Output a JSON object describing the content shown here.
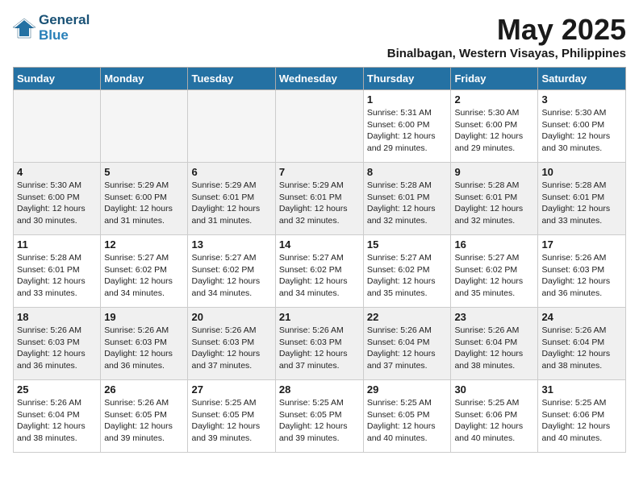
{
  "header": {
    "logo_line1": "General",
    "logo_line2": "Blue",
    "month_year": "May 2025",
    "location": "Binalbagan, Western Visayas, Philippines"
  },
  "days_of_week": [
    "Sunday",
    "Monday",
    "Tuesday",
    "Wednesday",
    "Thursday",
    "Friday",
    "Saturday"
  ],
  "weeks": [
    [
      {
        "day": "",
        "info": ""
      },
      {
        "day": "",
        "info": ""
      },
      {
        "day": "",
        "info": ""
      },
      {
        "day": "",
        "info": ""
      },
      {
        "day": "1",
        "info": "Sunrise: 5:31 AM\nSunset: 6:00 PM\nDaylight: 12 hours\nand 29 minutes."
      },
      {
        "day": "2",
        "info": "Sunrise: 5:30 AM\nSunset: 6:00 PM\nDaylight: 12 hours\nand 29 minutes."
      },
      {
        "day": "3",
        "info": "Sunrise: 5:30 AM\nSunset: 6:00 PM\nDaylight: 12 hours\nand 30 minutes."
      }
    ],
    [
      {
        "day": "4",
        "info": "Sunrise: 5:30 AM\nSunset: 6:00 PM\nDaylight: 12 hours\nand 30 minutes."
      },
      {
        "day": "5",
        "info": "Sunrise: 5:29 AM\nSunset: 6:00 PM\nDaylight: 12 hours\nand 31 minutes."
      },
      {
        "day": "6",
        "info": "Sunrise: 5:29 AM\nSunset: 6:01 PM\nDaylight: 12 hours\nand 31 minutes."
      },
      {
        "day": "7",
        "info": "Sunrise: 5:29 AM\nSunset: 6:01 PM\nDaylight: 12 hours\nand 32 minutes."
      },
      {
        "day": "8",
        "info": "Sunrise: 5:28 AM\nSunset: 6:01 PM\nDaylight: 12 hours\nand 32 minutes."
      },
      {
        "day": "9",
        "info": "Sunrise: 5:28 AM\nSunset: 6:01 PM\nDaylight: 12 hours\nand 32 minutes."
      },
      {
        "day": "10",
        "info": "Sunrise: 5:28 AM\nSunset: 6:01 PM\nDaylight: 12 hours\nand 33 minutes."
      }
    ],
    [
      {
        "day": "11",
        "info": "Sunrise: 5:28 AM\nSunset: 6:01 PM\nDaylight: 12 hours\nand 33 minutes."
      },
      {
        "day": "12",
        "info": "Sunrise: 5:27 AM\nSunset: 6:02 PM\nDaylight: 12 hours\nand 34 minutes."
      },
      {
        "day": "13",
        "info": "Sunrise: 5:27 AM\nSunset: 6:02 PM\nDaylight: 12 hours\nand 34 minutes."
      },
      {
        "day": "14",
        "info": "Sunrise: 5:27 AM\nSunset: 6:02 PM\nDaylight: 12 hours\nand 34 minutes."
      },
      {
        "day": "15",
        "info": "Sunrise: 5:27 AM\nSunset: 6:02 PM\nDaylight: 12 hours\nand 35 minutes."
      },
      {
        "day": "16",
        "info": "Sunrise: 5:27 AM\nSunset: 6:02 PM\nDaylight: 12 hours\nand 35 minutes."
      },
      {
        "day": "17",
        "info": "Sunrise: 5:26 AM\nSunset: 6:03 PM\nDaylight: 12 hours\nand 36 minutes."
      }
    ],
    [
      {
        "day": "18",
        "info": "Sunrise: 5:26 AM\nSunset: 6:03 PM\nDaylight: 12 hours\nand 36 minutes."
      },
      {
        "day": "19",
        "info": "Sunrise: 5:26 AM\nSunset: 6:03 PM\nDaylight: 12 hours\nand 36 minutes."
      },
      {
        "day": "20",
        "info": "Sunrise: 5:26 AM\nSunset: 6:03 PM\nDaylight: 12 hours\nand 37 minutes."
      },
      {
        "day": "21",
        "info": "Sunrise: 5:26 AM\nSunset: 6:03 PM\nDaylight: 12 hours\nand 37 minutes."
      },
      {
        "day": "22",
        "info": "Sunrise: 5:26 AM\nSunset: 6:04 PM\nDaylight: 12 hours\nand 37 minutes."
      },
      {
        "day": "23",
        "info": "Sunrise: 5:26 AM\nSunset: 6:04 PM\nDaylight: 12 hours\nand 38 minutes."
      },
      {
        "day": "24",
        "info": "Sunrise: 5:26 AM\nSunset: 6:04 PM\nDaylight: 12 hours\nand 38 minutes."
      }
    ],
    [
      {
        "day": "25",
        "info": "Sunrise: 5:26 AM\nSunset: 6:04 PM\nDaylight: 12 hours\nand 38 minutes."
      },
      {
        "day": "26",
        "info": "Sunrise: 5:26 AM\nSunset: 6:05 PM\nDaylight: 12 hours\nand 39 minutes."
      },
      {
        "day": "27",
        "info": "Sunrise: 5:25 AM\nSunset: 6:05 PM\nDaylight: 12 hours\nand 39 minutes."
      },
      {
        "day": "28",
        "info": "Sunrise: 5:25 AM\nSunset: 6:05 PM\nDaylight: 12 hours\nand 39 minutes."
      },
      {
        "day": "29",
        "info": "Sunrise: 5:25 AM\nSunset: 6:05 PM\nDaylight: 12 hours\nand 40 minutes."
      },
      {
        "day": "30",
        "info": "Sunrise: 5:25 AM\nSunset: 6:06 PM\nDaylight: 12 hours\nand 40 minutes."
      },
      {
        "day": "31",
        "info": "Sunrise: 5:25 AM\nSunset: 6:06 PM\nDaylight: 12 hours\nand 40 minutes."
      }
    ]
  ]
}
